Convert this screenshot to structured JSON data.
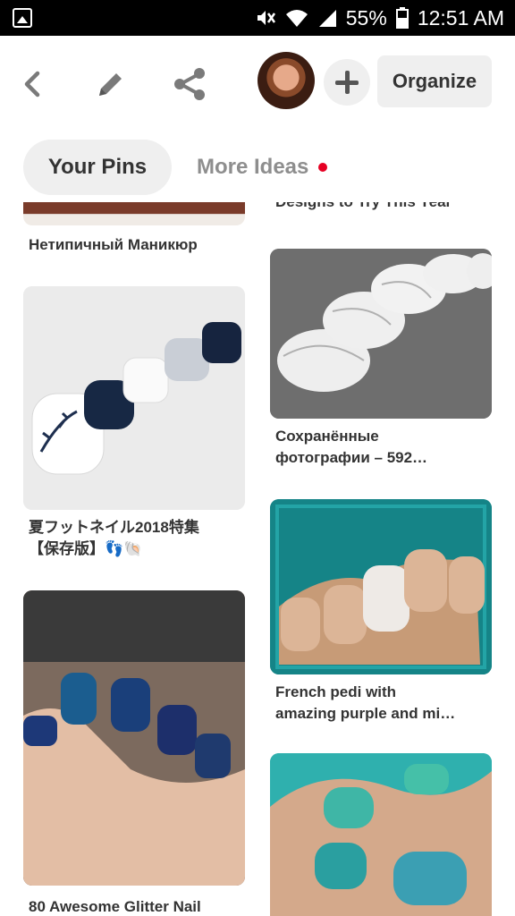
{
  "status_bar": {
    "battery": "55%",
    "time": "12:51 AM"
  },
  "header": {
    "organize_label": "Organize"
  },
  "tabs": {
    "your_pins": "Your Pins",
    "more_ideas": "More Ideas"
  },
  "pins": {
    "left": [
      {
        "caption": "Нетипичный Маникюр"
      },
      {
        "caption_line1": "夏フットネイル2018特集",
        "caption_line2": "【保存版】👣🐚"
      },
      {
        "caption": "80 Awesome Glitter Nail"
      }
    ],
    "right": [
      {
        "caption": "Designs to Try This Year"
      },
      {
        "caption_line1": "Сохранённые",
        "caption_line2": "фотографии – 592…"
      },
      {
        "caption_line1": "French pedi with",
        "caption_line2": "amazing purple and mi…"
      },
      {
        "caption": ""
      }
    ]
  },
  "colors": {
    "accent_dot": "#e60023",
    "chip_bg": "#efefef"
  }
}
